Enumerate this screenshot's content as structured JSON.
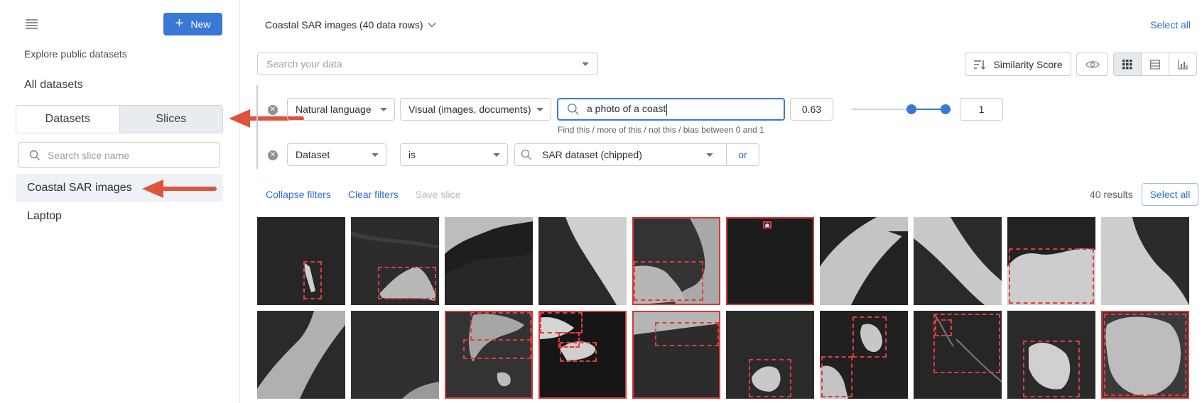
{
  "sidebar": {
    "new_label": "New",
    "explore_label": "Explore public datasets",
    "all_datasets_label": "All datasets",
    "tabs": [
      "Datasets",
      "Slices"
    ],
    "active_tab": "Slices",
    "slice_search_placeholder": "Search slice name",
    "slices": [
      {
        "label": "Coastal SAR images",
        "selected": true
      },
      {
        "label": "Laptop",
        "selected": false
      }
    ]
  },
  "main": {
    "title": "Coastal SAR images (40 data rows)",
    "select_all_top": "Select all",
    "search_placeholder": "Search your data",
    "similarity_label": "Similarity Score",
    "filters": {
      "row1": {
        "type": "Natural language",
        "modality": "Visual (images, documents)",
        "query": "a photo of a coast",
        "min_value": "0.63",
        "max_value": "1",
        "slider_low": 0.63,
        "slider_high": 1,
        "hint": "Find this / more of this / not this / bias between 0 and 1"
      },
      "row2": {
        "field": "Dataset",
        "operator": "is",
        "value": "SAR dataset (chipped)",
        "or_label": "or"
      }
    },
    "actions": {
      "collapse": "Collapse filters",
      "clear": "Clear filters",
      "save": "Save slice"
    },
    "results_count": "40 results",
    "select_all_label": "Select all",
    "accent_color": "#3a78d6",
    "annotation_color": "#e03c3c"
  }
}
